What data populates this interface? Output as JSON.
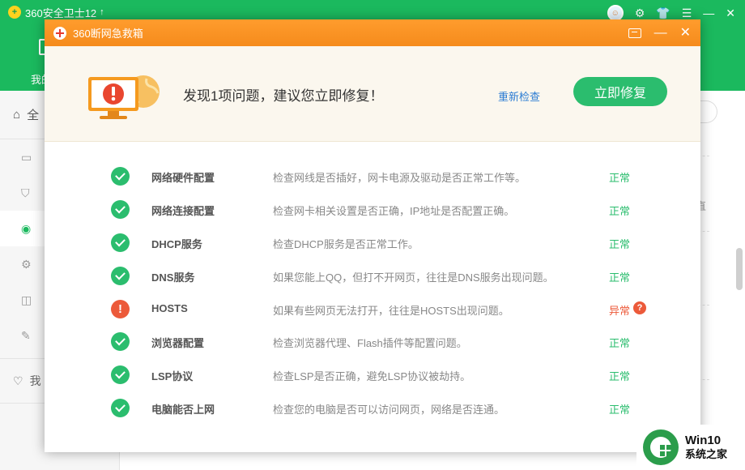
{
  "app": {
    "title": "360安全卫士12",
    "upgrade_icon": "↑",
    "nav_label": "我的",
    "sidebar_head": "全",
    "sidebar_foot": "我"
  },
  "background": {
    "side_text": "直"
  },
  "dialog": {
    "title": "360断网急救箱",
    "banner": {
      "message": "发现1项问题，建议您立即修复！",
      "recheck_label": "重新检查",
      "fix_label": "立即修复"
    },
    "checks": [
      {
        "name": "网络硬件配置",
        "desc": "检查网线是否插好，网卡电源及驱动是否正常工作等。",
        "result": "正常",
        "status": "ok"
      },
      {
        "name": "网络连接配置",
        "desc": "检查网卡相关设置是否正确，IP地址是否配置正确。",
        "result": "正常",
        "status": "ok"
      },
      {
        "name": "DHCP服务",
        "desc": "检查DHCP服务是否正常工作。",
        "result": "正常",
        "status": "ok"
      },
      {
        "name": "DNS服务",
        "desc": "如果您能上QQ，但打不开网页，往往是DNS服务出现问题。",
        "result": "正常",
        "status": "ok"
      },
      {
        "name": "HOSTS",
        "desc": "如果有些网页无法打开，往往是HOSTS出现问题。",
        "result": "异常",
        "status": "error"
      },
      {
        "name": "浏览器配置",
        "desc": "检查浏览器代理、Flash插件等配置问题。",
        "result": "正常",
        "status": "ok"
      },
      {
        "name": "LSP协议",
        "desc": "检查LSP是否正确，避免LSP协议被劫持。",
        "result": "正常",
        "status": "ok"
      },
      {
        "name": "电脑能否上网",
        "desc": "检查您的电脑是否可以访问网页，网络是否连通。",
        "result": "正常",
        "status": "ok"
      }
    ],
    "error_symbol": "!",
    "help_symbol": "?"
  },
  "watermark": {
    "line1": "Win10",
    "line2": "系统之家"
  },
  "colors": {
    "brand_green": "#1bb95e",
    "ok_green": "#2bbd6e",
    "error_red": "#ec5a3a",
    "title_orange": "#f58b1c",
    "link_blue": "#2b7cd3"
  },
  "icons": [
    "search-icon",
    "gear-icon",
    "shield-icon",
    "globe-icon",
    "wrench-icon",
    "heart-icon",
    "feedback-icon",
    "minimize-icon",
    "close-icon",
    "check-icon",
    "warning-icon",
    "help-icon",
    "monitor-warning-icon"
  ]
}
